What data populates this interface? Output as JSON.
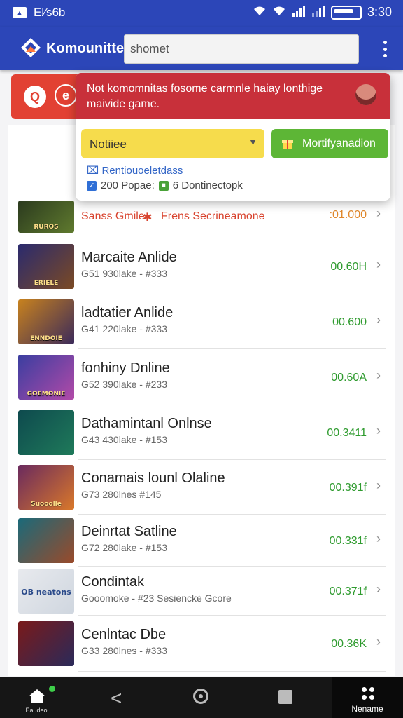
{
  "status": {
    "left_text": "El⁄s6b",
    "time": "3:30"
  },
  "appbar": {
    "title": "Komounitte",
    "search_value": "shomet"
  },
  "popup": {
    "banner_text": "Not komomnitas  fosome carmnle haiay lonthige maivide game.",
    "dropdown_label": "Notiiee",
    "green_button": "Mortifyanadion",
    "link_text": "Rentiouoeletdass",
    "check_text": "200 Popae:",
    "check_text2": "6 Dontinectopk"
  },
  "rows": [
    {
      "name": "Sanss Gmile",
      "sub": "Frens Secrineamone",
      "price": ":01.000",
      "thumb_label": "RUROS",
      "colors": [
        "#2b3a1e",
        "#5f7a2e"
      ]
    },
    {
      "name": "Marcaite Anlide",
      "sub": "G51 930lake - #333",
      "price": "00.60H",
      "thumb_label": "ERIELE",
      "colors": [
        "#2a2a6e",
        "#7b4a24"
      ]
    },
    {
      "name": "ladtatier Anlide",
      "sub": "G41 220lake - #333",
      "price": "00.600",
      "thumb_label": "ENNDOIE",
      "colors": [
        "#c8821e",
        "#3b2a5a"
      ]
    },
    {
      "name": "fonhiny Dnline",
      "sub": "G52 390lake - #233",
      "price": "00.60A",
      "thumb_label": "GOEMONIE",
      "colors": [
        "#3a3ea0",
        "#b24aa8"
      ]
    },
    {
      "name": "Dathamintanl Onlnse",
      "sub": "G43 430lake - #153",
      "price": "00.3411",
      "thumb_label": "",
      "colors": [
        "#0e4a4e",
        "#1f7a5a"
      ]
    },
    {
      "name": "Conamais lounl Olaline",
      "sub": "G73 280lnes   #145",
      "price": "00.391f",
      "thumb_label": "Suooolle",
      "colors": [
        "#6a2a5e",
        "#d9782a"
      ]
    },
    {
      "name": "Deinrtat Satline",
      "sub": "G72 280lake - #153",
      "price": "00.331f",
      "thumb_label": "",
      "colors": [
        "#1a6a7a",
        "#9a4a2a"
      ]
    },
    {
      "name": "Condintak",
      "sub": "Gooomoke - #23  Sesienckė Gcore",
      "price": "00.371f",
      "thumb_label": "OB neatons",
      "colors": [
        "#e8eaee",
        "#cfd6df"
      ]
    },
    {
      "name": "Cenlntac Dbe",
      "sub": "G33 280lnes - #333",
      "price": "00.36K",
      "thumb_label": "",
      "colors": [
        "#7a1a1a",
        "#2a2a5a"
      ]
    }
  ],
  "nav": {
    "home_label": "Eaudeo",
    "menu_label": "Nename"
  },
  "colors": {
    "primary": "#2c46b8",
    "red": "#e24133",
    "banner": "#c8303a",
    "yellow": "#f6dc4c",
    "green": "#5db636",
    "price_green": "#2f9b2f"
  }
}
